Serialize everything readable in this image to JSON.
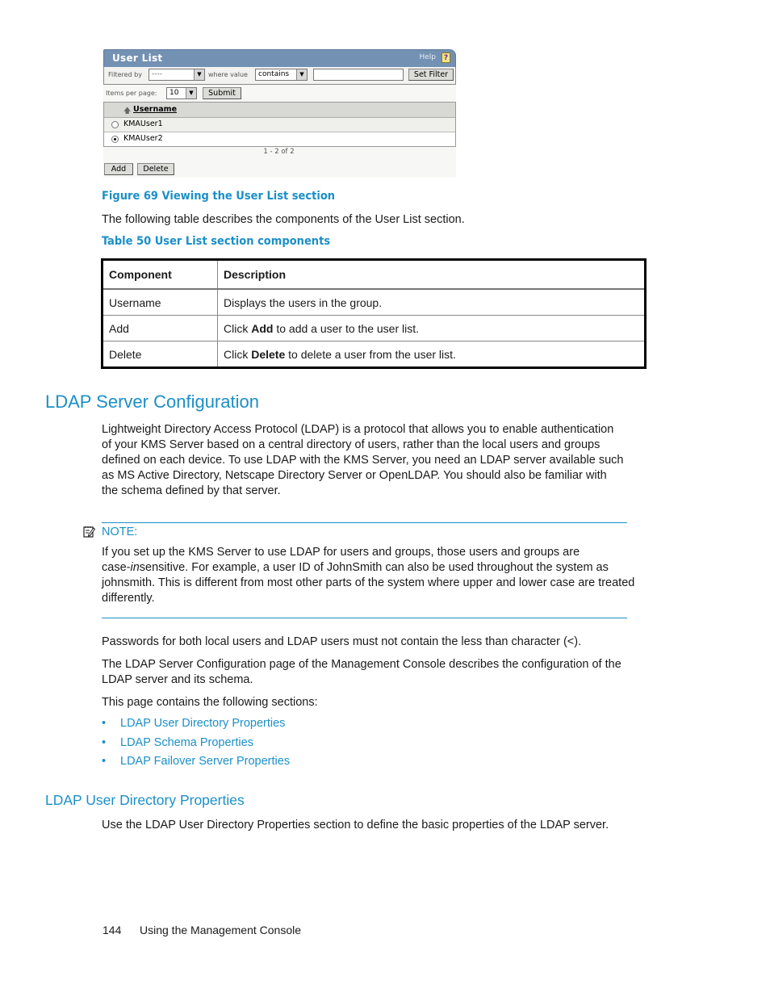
{
  "screenshot": {
    "title": "User List",
    "help_label": "Help",
    "help_icon": "?",
    "filter": {
      "filtered_by_label": "Filtered by",
      "filtered_by_value": "----",
      "where_value_label": "where value",
      "operator_value": "contains",
      "value_input": "",
      "set_filter_label": "Set Filter"
    },
    "items_per_page_label": "Items per page:",
    "items_per_page_value": "10",
    "submit_label": "Submit",
    "column_header": "Username",
    "sort_icon": "sort-ascending-icon",
    "rows": [
      {
        "username": "KMAUser1",
        "selected": false
      },
      {
        "username": "KMAUser2",
        "selected": true
      }
    ],
    "pager": "1 - 2 of 2",
    "add_label": "Add",
    "delete_label": "Delete"
  },
  "figure_caption": "Figure 69 Viewing the User List section",
  "intro_text": "The following table describes the components of the User List section.",
  "table_caption": "Table 50 User List section components",
  "table": {
    "headers": [
      "Component",
      "Description"
    ],
    "rows": [
      {
        "component": "Username",
        "description_pre": "Displays the users in the group.",
        "description_bold": "",
        "description_post": ""
      },
      {
        "component": "Add",
        "description_pre": "Click ",
        "description_bold": "Add",
        "description_post": " to add a user to the user list."
      },
      {
        "component": "Delete",
        "description_pre": "Click ",
        "description_bold": "Delete",
        "description_post": " to delete a user from the user list."
      }
    ]
  },
  "section": {
    "title": "LDAP Server Configuration",
    "paragraph_lines": [
      "Lightweight Directory Access Protocol (LDAP) is a protocol that allows you to enable authentication",
      "of your KMS Server based on a central directory of users, rather than the local users and groups",
      "defined on each device. To use LDAP with the KMS Server, you need an LDAP server available such",
      "as MS Active Directory, Netscape Directory Server or OpenLDAP. You should also be familiar with",
      "the schema defined by that server."
    ],
    "note": {
      "icon": "note-icon",
      "label": "NOTE:",
      "line1": "If you set up the KMS Server to use LDAP for users and groups, those users and groups are",
      "line2_pre": "case-",
      "line2_italic": "in",
      "line2_post": "sensitive. For example, a user ID of JohnSmith can also be used throughout the system as",
      "line3": "johnsmith. This is different from most other parts of the system where upper and lower case are treated",
      "line4": "differently."
    },
    "passwords_text": "Passwords for both local users and LDAP users must not contain the less than character (<).",
    "config_lines": [
      "The LDAP Server Configuration page of the Management Console describes the configuration of the",
      "LDAP server and its schema."
    ],
    "sections_intro": "This page contains the following sections:",
    "links": [
      "LDAP User Directory Properties",
      "LDAP Schema Properties",
      "LDAP Failover Server Properties"
    ]
  },
  "subsection": {
    "title": "LDAP User Directory Properties",
    "text": "Use the LDAP User Directory Properties section to define the basic properties of the LDAP server."
  },
  "footer": {
    "page_number": "144",
    "chapter": "Using the Management Console"
  }
}
